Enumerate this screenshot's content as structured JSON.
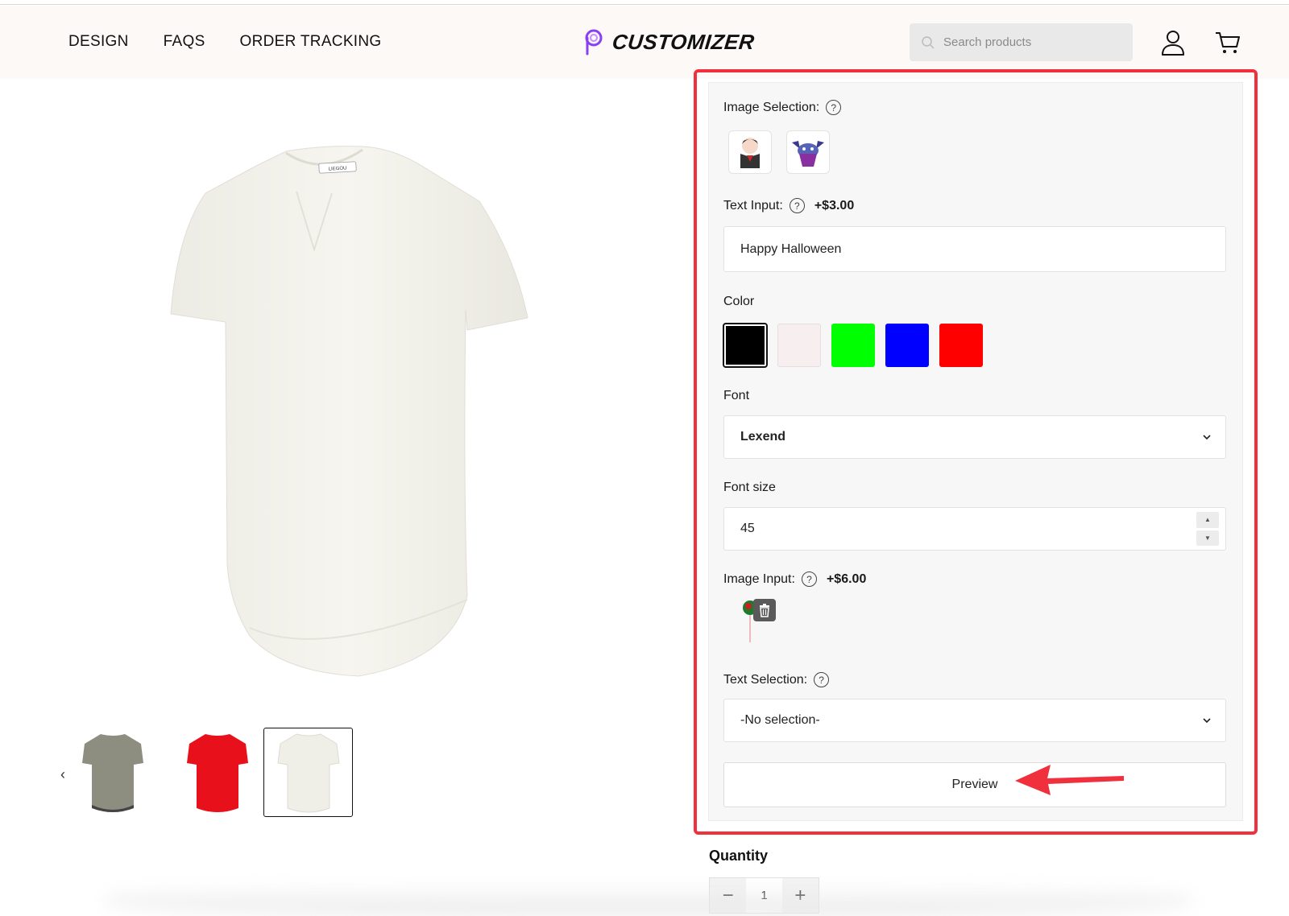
{
  "header": {
    "nav": [
      "DESIGN",
      "FAQS",
      "ORDER TRACKING"
    ],
    "brand": "CUSTOMIZER",
    "search_placeholder": "Search products"
  },
  "customizer": {
    "image_selection_label": "Image Selection:",
    "text_input_label": "Text Input:",
    "text_input_price": "+$3.00",
    "text_input_value": "Happy Halloween",
    "color_label": "Color",
    "colors": [
      "#000000",
      "#f7efef",
      "#00ff00",
      "#0000ff",
      "#ff0000"
    ],
    "selected_color": "#000000",
    "font_label": "Font",
    "font_value": "Lexend",
    "font_size_label": "Font size",
    "font_size_value": "45",
    "image_input_label": "Image Input:",
    "image_input_price": "+$6.00",
    "text_selection_label": "Text Selection:",
    "text_selection_value": "-No selection-",
    "preview_label": "Preview"
  },
  "quantity": {
    "label": "Quantity",
    "value": "1"
  },
  "icons": {
    "help": "?",
    "prev": "‹"
  }
}
